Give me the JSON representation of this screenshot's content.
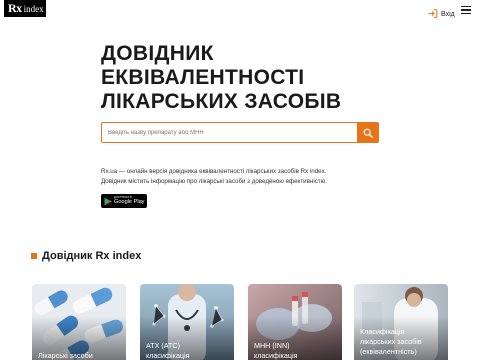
{
  "header": {
    "logo_rx": "Rx",
    "logo_index": "index",
    "login_label": "Вхід"
  },
  "hero": {
    "title_lines": [
      "ДОВІДНИК",
      "ЕКВІВАЛЕНТНОСТІ",
      "ЛІКАРСЬКИХ ЗАСОБІВ"
    ]
  },
  "search": {
    "placeholder": "Введіть назву препарату або МНН",
    "value": ""
  },
  "description": {
    "line1": "Rx.ua — онлайн версія довідника еквівалентності лікарських засобів Rx index.",
    "line2": "Довідник містить інформацію про лікарські засоби з доведеною ефективністю."
  },
  "google_play": {
    "small": "ДОСТУПНО В",
    "big": "Google Play"
  },
  "section": {
    "title": "Довідник Rx index"
  },
  "cards": [
    {
      "lines": [
        "Лікарські засоби"
      ]
    },
    {
      "lines": [
        "АТХ (АТС)",
        "класифікація"
      ]
    },
    {
      "lines": [
        "МНН (INN)",
        "класифікація"
      ]
    },
    {
      "lines": [
        "Класифікація",
        "лікарських засобів",
        "(еквівалентність)"
      ]
    }
  ],
  "colors": {
    "accent": "#e8741a",
    "text": "#1a1a1a",
    "logo_bg": "#000000"
  }
}
